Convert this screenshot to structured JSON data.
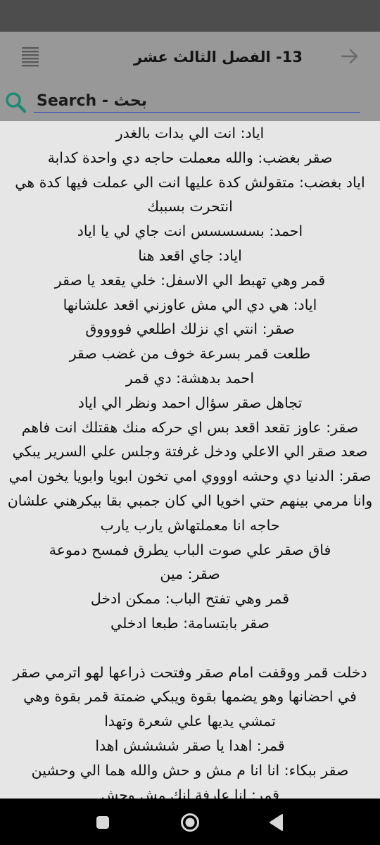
{
  "app_bar": {
    "title": "13- الفصل الثالث عشر",
    "menu_icon": "list-icon",
    "forward_icon": "arrow-right-icon"
  },
  "search": {
    "placeholder": "Search - بحث",
    "icon": "search-icon",
    "accent_color": "#3f51b5",
    "icon_color": "#1f8a70"
  },
  "content": {
    "text": "اياد: انت الي بدات بالغدر\nصقر بغضب: والله معملت حاجه دي واحدة كدابة\nاياد بغضب: متقولش كدة عليها انت الي عملت فيها كدة هي انتحرت بسببك\nاحمد: بسسسسس انت جاي لي يا اياد\nاياد: جاي اقعد هنا\nقمر وهي تهبط الي الاسفل: خلي يقعد يا صقر\nاياد: هي دي الي مش عاوزني اقعد علشانها\nصقر: انتي اي نزلك اطلعي فووووق\nطلعت قمر بسرعة خوف من غضب صقر\nاحمد بدهشة: دي قمر\nتجاهل صقر سؤال احمد ونظر الي اياد\nصقر: عاوز تقعد اقعد بس اي حركه منك هقتلك انت فاهم\nصعد صقر الي الاعلي ودخل غرفتة وجلس علي السرير يبكي\nصقر: الدنيا دي وحشه اوووي امي تخون ابويا وابويا يخون امي وانا مرمي بينهم حتي اخويا الي كان جمبي بقا بيكرهني علشان حاجه انا معملتهاش يارب يارب\nفاق صقر علي صوت الباب يطرق فمسح دموعة\nصقر: مين\nقمر وهي تفتح الباب: ممكن ادخل\nصقر بابتسامة: طبعا ادخلي\n\nدخلت قمر ووقفت امام صقر وفتحت ذراعها لهو اترمي صقر في احضانها وهو يضمها بقوة ويبكي ضمتة قمر بقوة وهي تمشي يديها علي شعرة وتهدا\nقمر: اهدا يا صقر شششش اهدا\nصقر ببكاء: انا انا م مش و حش والله هما الي وحشين\nقمر: انا عارفة انك مش وحش"
  },
  "nav": {
    "recents_icon": "square-icon",
    "home_icon": "circle-icon",
    "back_icon": "triangle-back-icon"
  }
}
